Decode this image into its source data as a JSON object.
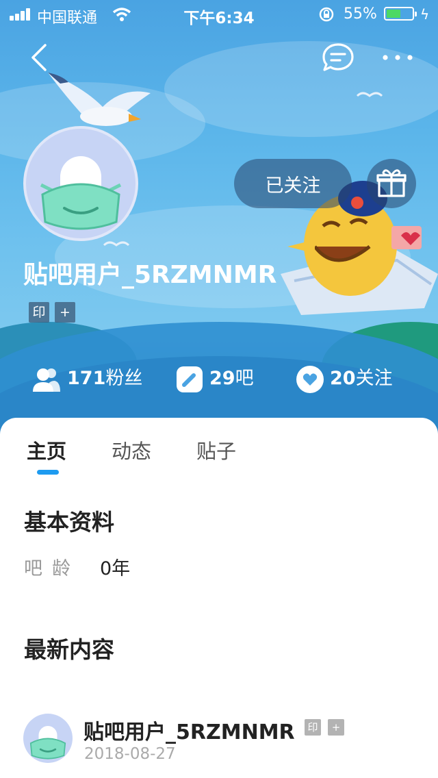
{
  "status_bar": {
    "carrier": "中国联通",
    "time": "下午6:34",
    "battery_pct": "55%",
    "battery_level": 0.55,
    "battery_color": "#4cd964"
  },
  "nav": {
    "back_icon": "chevron-left-icon",
    "chat_icon": "chat-bubble-icon",
    "more_icon": "more-dots-icon"
  },
  "profile": {
    "username": "贴吧用户_5RZMNMR",
    "badge_seal": "印",
    "badge_add": "+",
    "follow_label": "已关注",
    "gift_icon": "gift-icon"
  },
  "stats": [
    {
      "icon": "users-icon",
      "value": "171",
      "label": "粉丝"
    },
    {
      "icon": "pencil-icon",
      "value": "29",
      "label": "吧"
    },
    {
      "icon": "heart-icon",
      "value": "20",
      "label": "关注"
    }
  ],
  "tabs": [
    {
      "label": "主页",
      "active": true
    },
    {
      "label": "动态",
      "active": false
    },
    {
      "label": "贴子",
      "active": false
    }
  ],
  "basic_info": {
    "title": "基本资料",
    "age_label": "吧龄",
    "age_value": "0年"
  },
  "latest": {
    "title": "最新内容",
    "post": {
      "author": "贴吧用户_5RZMNMR",
      "badge_seal": "印",
      "badge_add": "+",
      "date": "2018-08-27"
    }
  },
  "colors": {
    "accent": "#1e9bf0",
    "banner": "#5bb5ea"
  }
}
